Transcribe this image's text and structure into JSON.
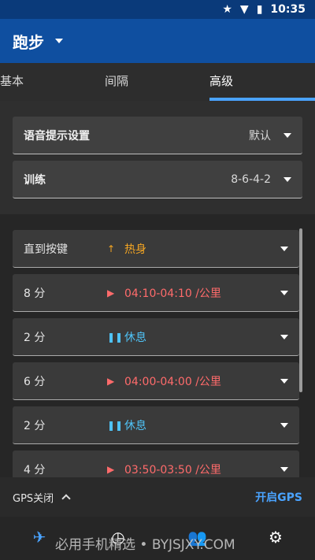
{
  "status_bar": {
    "time": "10:35"
  },
  "app_bar": {
    "title": "跑步"
  },
  "tabs": [
    {
      "label": "基本"
    },
    {
      "label": "间隔"
    },
    {
      "label": "高级"
    }
  ],
  "settings": {
    "voice": {
      "label": "语音提示设置",
      "value": "默认"
    },
    "training": {
      "label": "训练",
      "value": "8-6-4-2"
    }
  },
  "steps": [
    {
      "label": "直到按键",
      "icon": "arrow-up-icon",
      "text": "热身"
    },
    {
      "label": "8 分",
      "icon": "play-icon",
      "text": "04:10-04:10 /公里"
    },
    {
      "label": "2 分",
      "icon": "pause-icon",
      "text": "休息"
    },
    {
      "label": "6 分",
      "icon": "play-icon",
      "text": "04:00-04:00 /公里"
    },
    {
      "label": "2 分",
      "icon": "pause-icon",
      "text": "休息"
    },
    {
      "label": "4 分",
      "icon": "play-icon",
      "text": "03:50-03:50 /公里"
    }
  ],
  "gps": {
    "status": "GPS关闭",
    "action": "开启GPS"
  },
  "watermark": "必用手机精选 • BYJSJXY.COM",
  "colors": {
    "accent": "#4aa3ff",
    "warmup": "#f5a623",
    "run": "#ff6b6b",
    "rest": "#4fc3f7"
  }
}
